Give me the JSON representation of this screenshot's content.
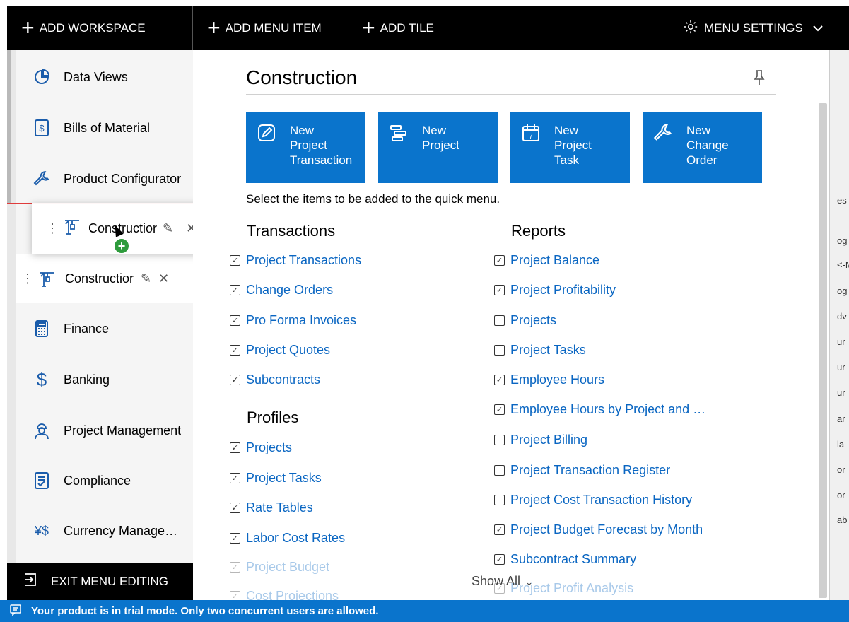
{
  "topbar": {
    "add_workspace": "ADD WORKSPACE",
    "add_menu_item": "ADD MENU ITEM",
    "add_tile": "ADD TILE",
    "menu_settings": "MENU SETTINGS"
  },
  "sidebar": {
    "items": [
      {
        "label": "Data Views",
        "icon": "pie-chart-icon"
      },
      {
        "label": "Bills of Material",
        "icon": "document-dollar-icon"
      },
      {
        "label": "Product Configurator",
        "icon": "wrench-icon"
      },
      {
        "label": "Construction",
        "icon": "crane-icon"
      },
      {
        "label": "Finance",
        "icon": "calculator-icon"
      },
      {
        "label": "Banking",
        "icon": "dollar-icon"
      },
      {
        "label": "Project Management",
        "icon": "worker-icon"
      },
      {
        "label": "Compliance",
        "icon": "checklist-icon"
      },
      {
        "label": "Currency Manage…",
        "icon": "currency-icon"
      }
    ],
    "dragged_label": "Constructior",
    "exit_label": "EXIT MENU EDITING"
  },
  "main": {
    "title": "Construction",
    "tiles": [
      {
        "label": "New\nProject\nTransaction",
        "icon": "pencil-square-icon"
      },
      {
        "label": "New\nProject",
        "icon": "gantt-icon"
      },
      {
        "label": "New\nProject\nTask",
        "icon": "calendar-icon"
      },
      {
        "label": "New\nChange\nOrder",
        "icon": "wrench-icon"
      }
    ],
    "hint": "Select the items to be added to the quick menu.",
    "transactions_title": "Transactions",
    "transactions": [
      {
        "label": "Project Transactions",
        "checked": true
      },
      {
        "label": "Change Orders",
        "checked": true
      },
      {
        "label": "Pro Forma Invoices",
        "checked": true
      },
      {
        "label": "Project Quotes",
        "checked": true
      },
      {
        "label": "Subcontracts",
        "checked": true
      }
    ],
    "profiles_title": "Profiles",
    "profiles": [
      {
        "label": "Projects",
        "checked": true
      },
      {
        "label": "Project Tasks",
        "checked": true
      },
      {
        "label": "Rate Tables",
        "checked": true
      },
      {
        "label": "Labor Cost Rates",
        "checked": true
      },
      {
        "label": "Project Budget",
        "checked": true
      },
      {
        "label": "Cost Projections",
        "checked": true
      }
    ],
    "reports_title": "Reports",
    "reports": [
      {
        "label": "Project Balance",
        "checked": true
      },
      {
        "label": "Project Profitability",
        "checked": true
      },
      {
        "label": "Projects",
        "checked": false
      },
      {
        "label": "Project Tasks",
        "checked": false
      },
      {
        "label": "Employee Hours",
        "checked": true
      },
      {
        "label": "Employee Hours by Project and …",
        "checked": true
      },
      {
        "label": "Project Billing",
        "checked": false
      },
      {
        "label": "Project Transaction Register",
        "checked": false
      },
      {
        "label": "Project Cost Transaction History",
        "checked": false
      },
      {
        "label": "Project Budget Forecast by Month",
        "checked": true
      },
      {
        "label": "Subcontract Summary",
        "checked": true
      },
      {
        "label": "Project Profit Analysis",
        "checked": true
      }
    ],
    "show_all": "Show All"
  },
  "right_panel": [
    "es",
    "og",
    "<-M",
    "og",
    "dv",
    "ur",
    "ur",
    "ur",
    "ar",
    "la",
    "or",
    "or",
    "ab"
  ],
  "status": {
    "text": "Your product is in trial mode. Only two concurrent users are allowed."
  },
  "colors": {
    "accent": "#0a74cc",
    "link": "#0a66c2",
    "topbar": "#000000"
  }
}
